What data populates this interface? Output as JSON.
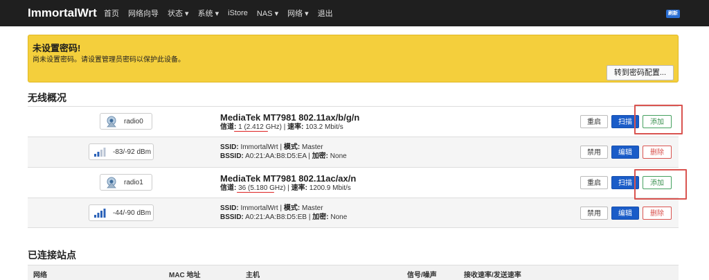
{
  "nav": {
    "brand": "ImmortalWrt",
    "items": [
      {
        "label": "首页",
        "caret": ""
      },
      {
        "label": "网络向导",
        "caret": ""
      },
      {
        "label": "状态",
        "caret": " ▾"
      },
      {
        "label": "系统",
        "caret": " ▾"
      },
      {
        "label": "iStore",
        "caret": ""
      },
      {
        "label": "NAS",
        "caret": " ▾"
      },
      {
        "label": "网络",
        "caret": " ▾"
      },
      {
        "label": "退出",
        "caret": ""
      }
    ],
    "badge": "刷新"
  },
  "alert": {
    "title": "未设置密码!",
    "message": "尚未设置密码。请设置管理员密码以保护此设备。",
    "button": "转到密码配置..."
  },
  "wireless": {
    "title": "无线概况",
    "rows": [
      {
        "kind": "radio",
        "badge": "radio0",
        "line1": "MediaTek MT7981 802.11ax/b/g/n",
        "l_chan": "信道:",
        "chan": " 1 (2.412 GHz) | ",
        "l_rate": "速率:",
        "rate": " 103.2 Mbit/s",
        "buttons": [
          "重启",
          "扫描",
          "添加"
        ]
      },
      {
        "kind": "net",
        "badge": "-83/-92 dBm",
        "l_ssid": "SSID:",
        "ssid": " ImmortalWrt | ",
        "l_mode": "模式:",
        "mode": " Master",
        "l_bssid": "BSSID:",
        "bssid": " A0:21:AA:B8:D5:EA | ",
        "l_enc": "加密:",
        "enc": " None",
        "buttons": [
          "禁用",
          "编辑",
          "删除"
        ]
      },
      {
        "kind": "radio",
        "badge": "radio1",
        "line1": "MediaTek MT7981 802.11ac/ax/n",
        "l_chan": "信道:",
        "chan": " 36 (5.180 GHz) | ",
        "l_rate": "速率:",
        "rate": " 1200.9 Mbit/s",
        "buttons": [
          "重启",
          "扫描",
          "添加"
        ]
      },
      {
        "kind": "net",
        "badge": "-44/-90 dBm",
        "l_ssid": "SSID:",
        "ssid": " ImmortalWrt | ",
        "l_mode": "模式:",
        "mode": " Master",
        "l_bssid": "BSSID:",
        "bssid": " A0:21:AA:B8:D5:EB | ",
        "l_enc": "加密:",
        "enc": " None",
        "buttons": [
          "禁用",
          "编辑",
          "删除"
        ]
      }
    ]
  },
  "stations": {
    "title": "已连接站点",
    "columns": [
      "网络",
      "MAC 地址",
      "主机",
      "信号/噪声",
      "接收速率/发送速率"
    ]
  },
  "icons": {
    "radio": "wifi-radio-icon",
    "signal": "signal-bars-icon"
  },
  "colors": {
    "navbar": "#1f1f1f",
    "alert": "#f4cf3c",
    "primary": "#1a5cc8",
    "add": "#44a05e",
    "delete": "#d9534f",
    "highlight": "#d9534f"
  }
}
